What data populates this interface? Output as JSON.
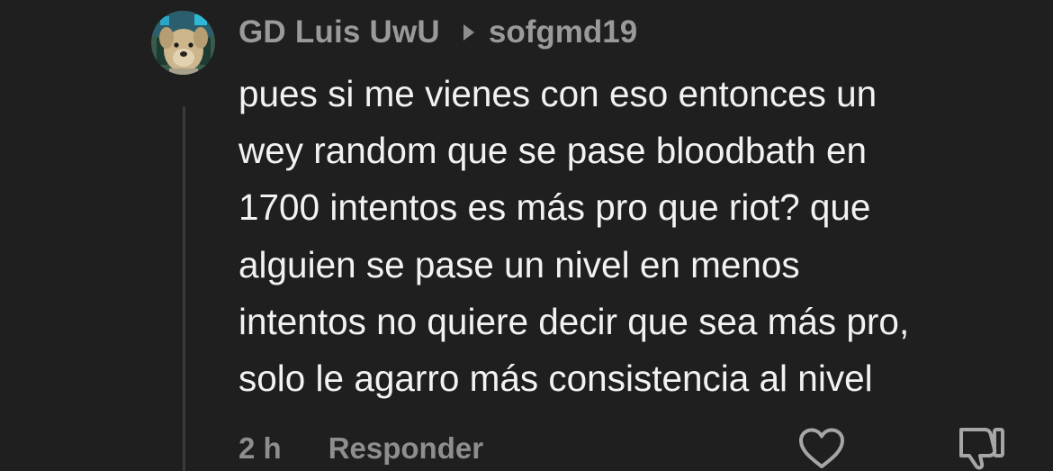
{
  "comment": {
    "author": "GD Luis UwU",
    "reply_to": "sofgmd19",
    "body_lines": [
      "pues si me vienes con eso entonces un",
      "wey random que se pase bloodbath en",
      "1700 intentos es más pro que riot? que",
      "alguien se pase un nivel en menos",
      "intentos no quiere decir que sea más pro,",
      "solo le agarro más consistencia al nivel"
    ],
    "timestamp": "2 h",
    "reply_label": "Responder"
  },
  "icons": {
    "avatar": "dog-face-avatar",
    "reply_arrow": "caret-right-icon",
    "like": "heart-icon",
    "dislike": "thumbs-down-icon"
  },
  "colors": {
    "background": "#1f1f1f",
    "body_text": "#f2f2f2",
    "muted_text": "#9a9a9a",
    "thread_line": "#3b3b3b"
  }
}
